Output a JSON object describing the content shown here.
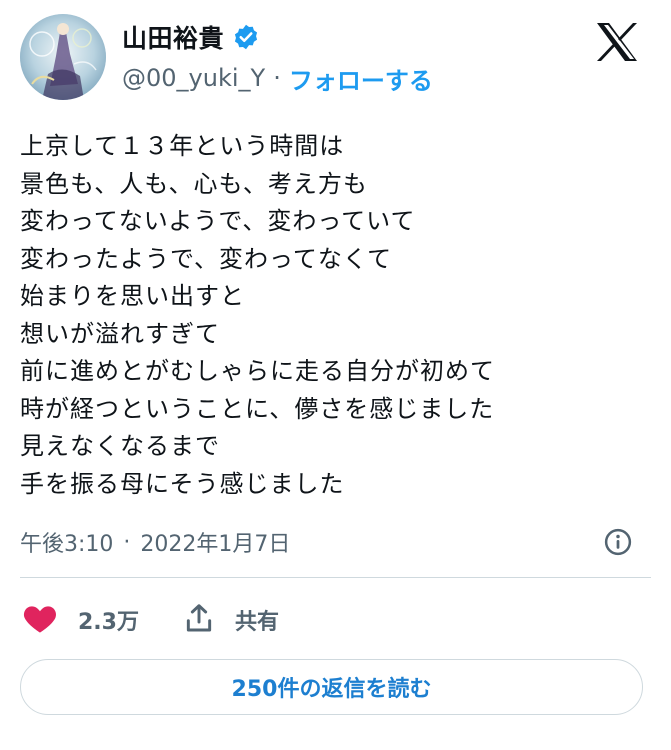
{
  "author": {
    "name": "山田裕貴",
    "handle": "@00_yuki_Y",
    "separator": "·",
    "follow_label": "フォローする",
    "verified": true
  },
  "tweet": {
    "lines": [
      "上京して１３年という時間は",
      "景色も、人も、心も、考え方も",
      "変わってないようで、変わっていて",
      "変わったようで、変わってなくて",
      "始まりを思い出すと",
      "想いが溢れすぎて",
      "前に進めとがむしゃらに走る自分が初めて",
      "時が経つということに、儚さを感じました",
      "見えなくなるまで",
      "手を振る母にそう感じました"
    ],
    "time": "午後3:10",
    "separator": "·",
    "date": "2022年1月7日"
  },
  "actions": {
    "like_count": "2.3万",
    "share_label": "共有"
  },
  "reply_button_label": "250件の返信を読む",
  "colors": {
    "accent": "#1d9bf0",
    "like": "#e0245e",
    "muted": "#536471",
    "text": "#0f1419",
    "border": "#cfd9de"
  },
  "icons": [
    "verified-badge-icon",
    "x-logo-icon",
    "info-icon",
    "heart-icon",
    "share-icon"
  ]
}
